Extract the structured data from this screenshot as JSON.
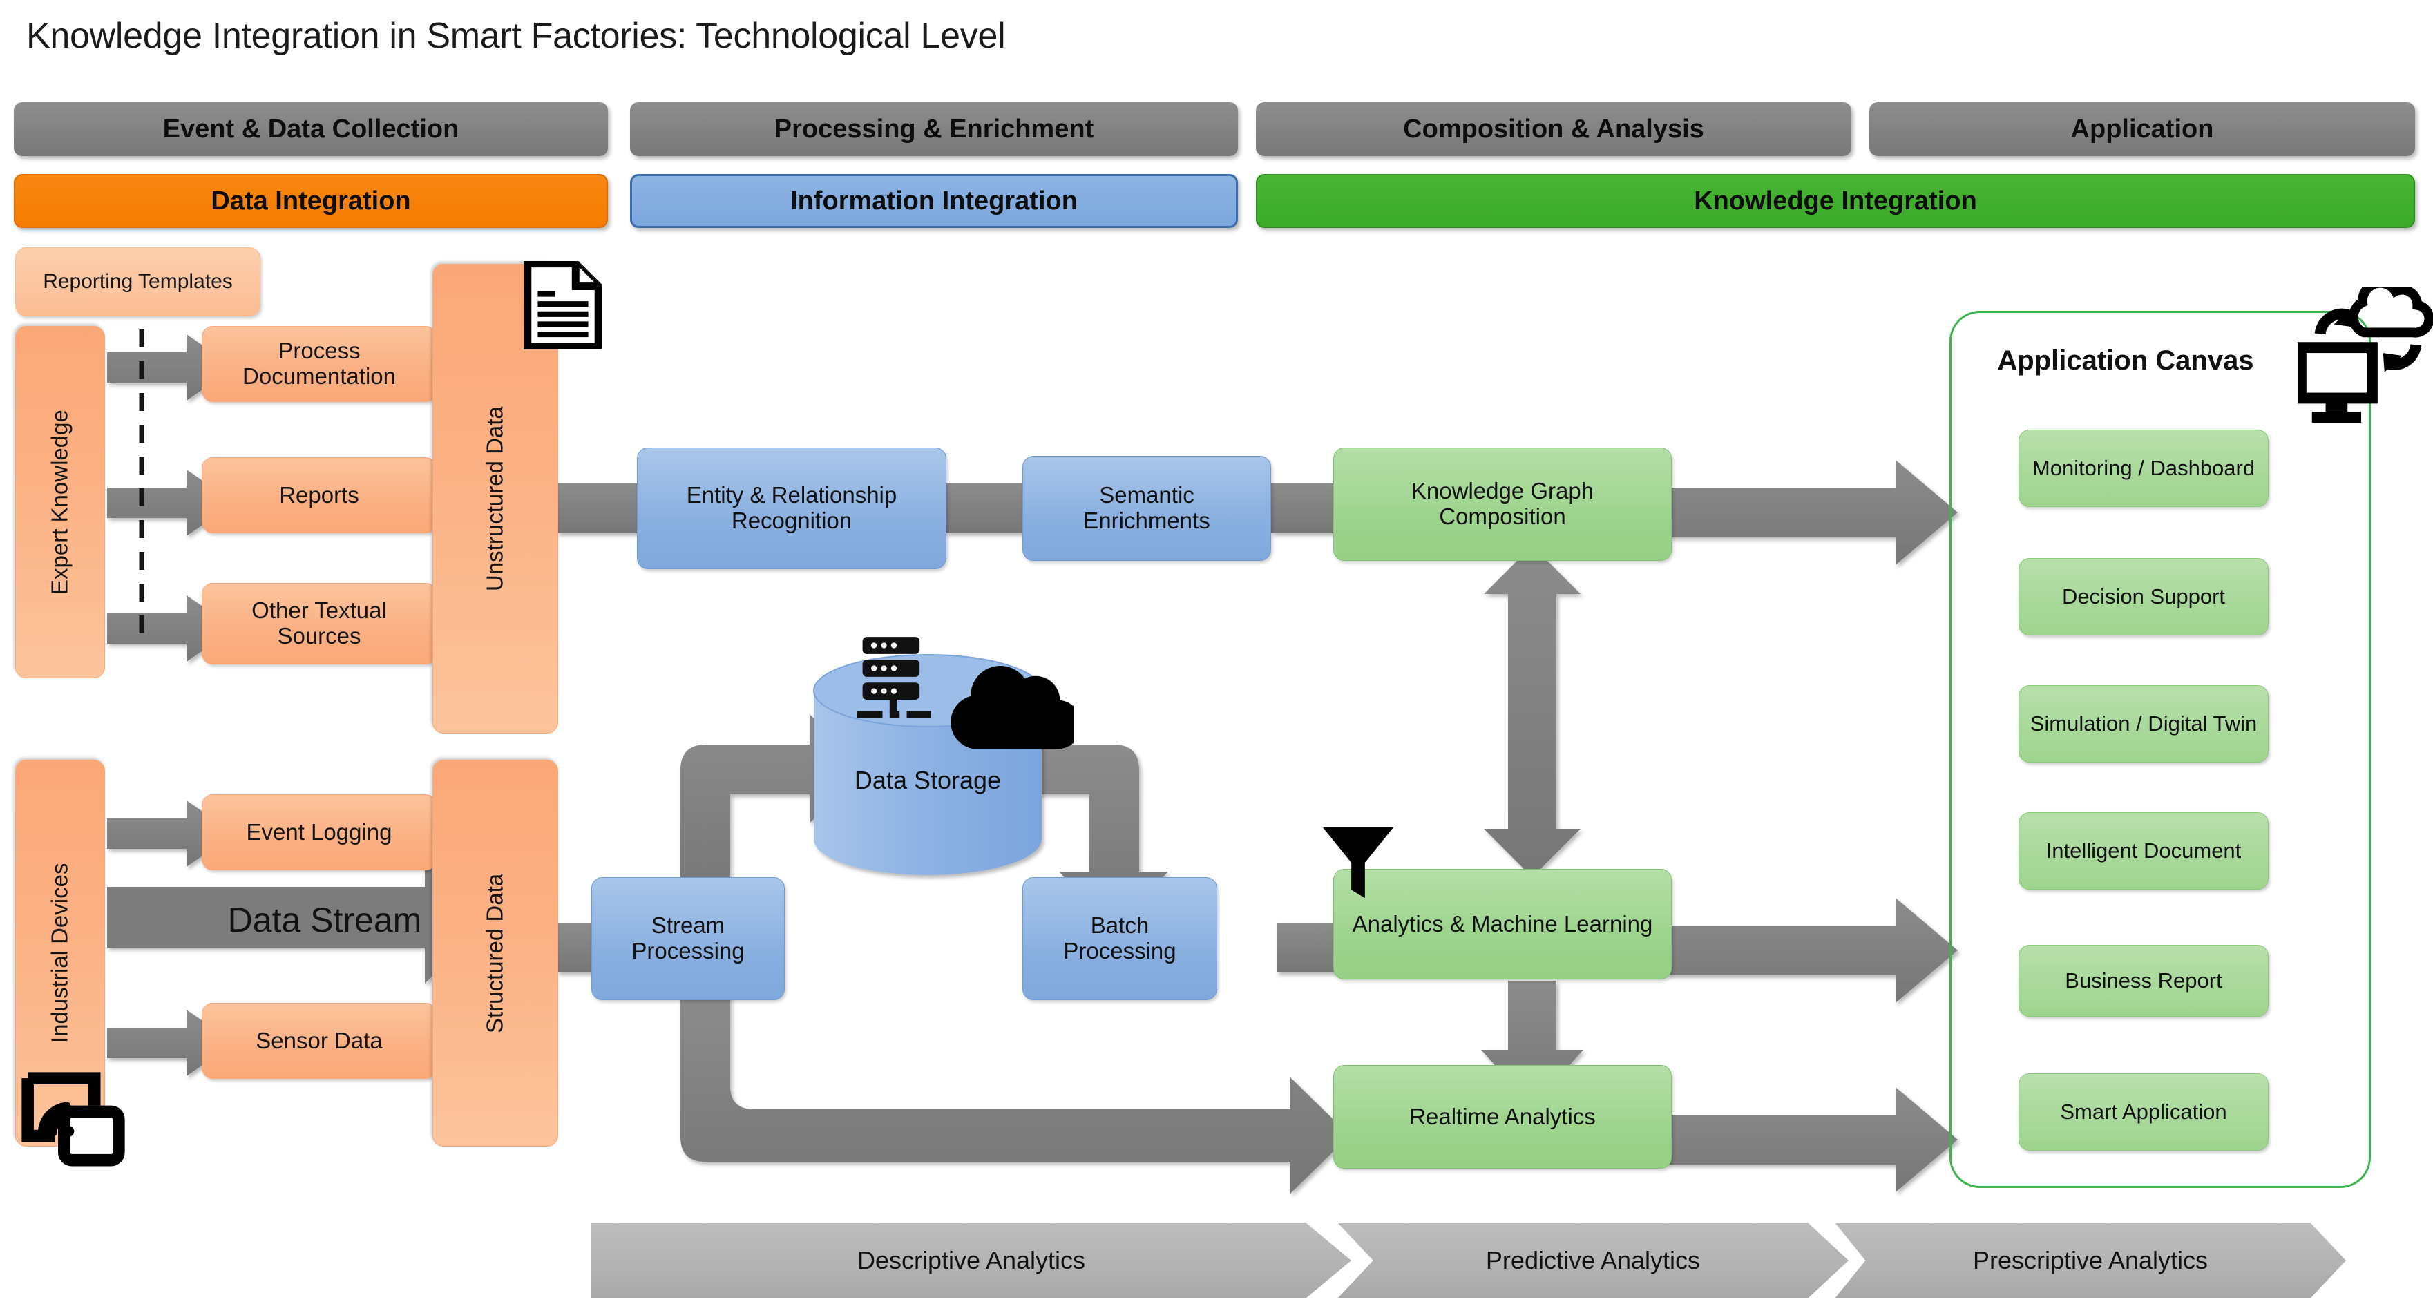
{
  "page": {
    "title": "Knowledge Integration in Smart Factories: Technological Level"
  },
  "phases": [
    {
      "label": "Event & Data Collection"
    },
    {
      "label": "Processing & Enrichment"
    },
    {
      "label": "Composition & Analysis"
    },
    {
      "label": "Application"
    }
  ],
  "layers": [
    {
      "label": "Data Integration",
      "color": "#f57c00"
    },
    {
      "label": "Information Integration",
      "color": "#8db3e2"
    },
    {
      "label": "Knowledge Integration",
      "color": "#48b533"
    }
  ],
  "collection": {
    "reporting_templates": "Reporting Templates",
    "expert_knowledge": "Expert Knowledge",
    "industrial_devices": "Industrial Devices",
    "unstructured_data": "Unstructured Data",
    "structured_data": "Structured Data",
    "data_stream": "Data Stream",
    "sources_text": [
      {
        "label": "Process Documentation"
      },
      {
        "label": "Reports"
      },
      {
        "label": "Other Textual Sources"
      }
    ],
    "sources_device": [
      {
        "label": "Event Logging"
      },
      {
        "label": "Sensor Data"
      }
    ]
  },
  "processing": {
    "entity_relationship": "Entity & Relationship Recognition",
    "semantic_enrichments": "Semantic Enrichments",
    "data_storage": "Data Storage",
    "stream_processing": "Stream Processing",
    "batch_processing": "Batch Processing"
  },
  "composition": {
    "knowledge_graph": "Knowledge Graph Composition",
    "analytics_ml": "Analytics & Machine Learning",
    "realtime_analytics": "Realtime Analytics"
  },
  "application": {
    "canvas_title": "Application Canvas",
    "items": [
      {
        "label": "Monitoring / Dashboard"
      },
      {
        "label": "Decision Support"
      },
      {
        "label": "Simulation / Digital Twin"
      },
      {
        "label": "Intelligent Document"
      },
      {
        "label": "Business Report"
      },
      {
        "label": "Smart Application"
      }
    ]
  },
  "analytics_band": [
    {
      "label": "Descriptive Analytics"
    },
    {
      "label": "Predictive Analytics"
    },
    {
      "label": "Prescriptive Analytics"
    }
  ],
  "icons": {
    "document": "document-icon",
    "iot_device": "iot-wireless-device-icon",
    "server_stack": "server-stack-icon",
    "cloud": "cloud-icon",
    "funnel": "funnel-filter-icon",
    "monitor_cloud_sync": "monitor-cloud-sync-icon"
  }
}
